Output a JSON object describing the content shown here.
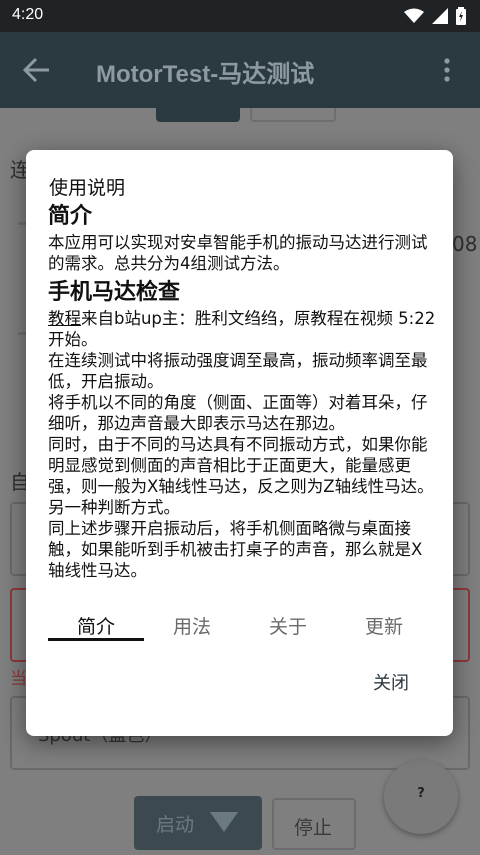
{
  "status_bar": {
    "time": "4:20"
  },
  "app_bar": {
    "title": "MotorTest-马达测试"
  },
  "background": {
    "char_1": "连",
    "char_2": "08",
    "char_3": "自",
    "char_4": "当",
    "spout_label": "Spout（蓝色）",
    "start_label": "启动",
    "stop_label": "停止",
    "fab_label": "?"
  },
  "dialog": {
    "title": "使用说明",
    "sections": {
      "intro_heading": "简介",
      "intro_text": "本应用可以实现对安卓智能手机的振动马达进行测试的需求。总共分为4组测试方法。",
      "check_heading": "手机马达检查",
      "tutorial_link": "教程",
      "tutorial_rest": "来自b站up主：胜利文绉绉，原教程在视频 5:22 开始。",
      "p1": "在连续测试中将振动强度调至最高，振动频率调至最低，开启振动。",
      "p2": "将手机以不同的角度（侧面、正面等）对着耳朵，仔细听，那边声音最大即表示马达在那边。",
      "p3": "同时，由于不同的马达具有不同振动方式，如果你能明显感觉到侧面的声音相比于正面更大，能量感更强，则一般为X轴线性马达，反之则为Z轴线性马达。",
      "p4": "另一种判断方式。",
      "p5": "同上述步骤开启振动后，将手机侧面略微与桌面接触，如果能听到手机被击打桌子的声音，那么就是X轴线性马达。"
    },
    "tabs": [
      "简介",
      "用法",
      "关于",
      "更新"
    ],
    "close_label": "关闭"
  }
}
